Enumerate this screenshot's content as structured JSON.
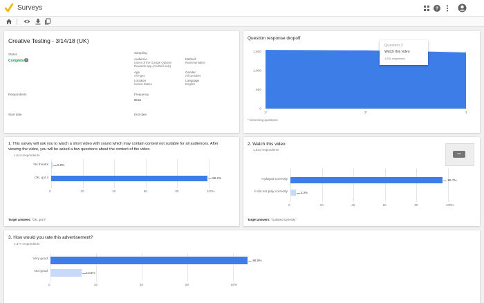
{
  "app": {
    "title": "Surveys"
  },
  "colors": {
    "accent": "#3d7de8",
    "accent_light": "#c8d9f9",
    "status_green": "#0f9d58",
    "logo_yellow": "#f4b400"
  },
  "header": {
    "icons": [
      "apps-grid-icon",
      "help-icon",
      "more-vert-icon",
      "account-icon"
    ]
  },
  "toolbar": {
    "icons": [
      "home-icon",
      "preview-eye-icon",
      "download-icon",
      "copy-icon"
    ]
  },
  "summary": {
    "title": "Creative Testing - 3/14/18 (UK)",
    "status_label": "Status",
    "status_value": "Complete",
    "sampling_label": "Sampling",
    "audience_label": "Audience",
    "audience_value": "Users of the Google Opinion Rewards app (Android only)",
    "method_label": "Method",
    "method_value": "Representative",
    "age_label": "Age",
    "age_value": "All Ages",
    "gender_label": "Gender",
    "gender_value": "All Genders",
    "location_label": "Location",
    "location_value": "United States",
    "language_label": "Language",
    "language_value": "English",
    "respondents_label": "Respondents",
    "frequency_label": "Frequency",
    "frequency_value": "Once",
    "start_label": "Start date",
    "end_label": "End date"
  },
  "dropoff": {
    "title": "Question response dropoff",
    "footnote": "* Screening questions",
    "tooltip_title": "Question 2",
    "tooltip_subtitle": "Watch this video",
    "tooltip_value": "1,531 responses"
  },
  "q1": {
    "title": "1.  This survey will ask you to watch a short video with sound which may contain content not suitable for all audiences. After viewing the video, you will be asked a few questions about the content of the video.",
    "respondents": "1,544 respondents",
    "target_label": "Target answers:",
    "target_value": "\"OK, got it\""
  },
  "q2": {
    "title": "2.  Watch this video",
    "respondents": "1,531 respondents",
    "target_label": "Target answers:",
    "target_value": "\"It played correctly\"",
    "video_menu": "•••"
  },
  "q3": {
    "title": "3.  How would you rate this advertisement?",
    "respondents": "1,477 respondents"
  },
  "chart_data": [
    {
      "type": "area",
      "title": "Question response dropoff",
      "x": [
        "1*",
        "2*",
        "3"
      ],
      "y_ticks": [
        "0",
        "500",
        "1,000",
        "1,500"
      ],
      "ylim": [
        0,
        1600
      ],
      "series": [
        {
          "values": [
            1544,
            1531,
            1477
          ]
        }
      ]
    },
    {
      "type": "bar",
      "categories": [
        "No thanks",
        "OK, got it"
      ],
      "values": [
        0.8,
        99.2
      ],
      "labels": [
        "0.8%",
        "99.2%"
      ],
      "x_ticks": [
        "0",
        "20",
        "40",
        "60",
        "80",
        "100%"
      ],
      "xlim": [
        0,
        100
      ]
    },
    {
      "type": "bar",
      "categories": [
        "It played correctly",
        "It did not play correctly"
      ],
      "values": [
        96.7,
        3.3
      ],
      "labels": [
        "96.7%",
        "3.3%"
      ],
      "x_ticks": [
        "0",
        "20",
        "40",
        "60",
        "80",
        "100%"
      ],
      "xlim": [
        0,
        100
      ]
    },
    {
      "type": "bar",
      "categories": [
        "Very good",
        "Not good"
      ],
      "values": [
        86.5,
        13.5
      ],
      "labels": [
        "86.5%",
        "13.5%"
      ],
      "x_ticks": [
        "0",
        "20",
        "40",
        "60",
        "80%"
      ],
      "xlim": [
        0,
        100
      ]
    }
  ]
}
